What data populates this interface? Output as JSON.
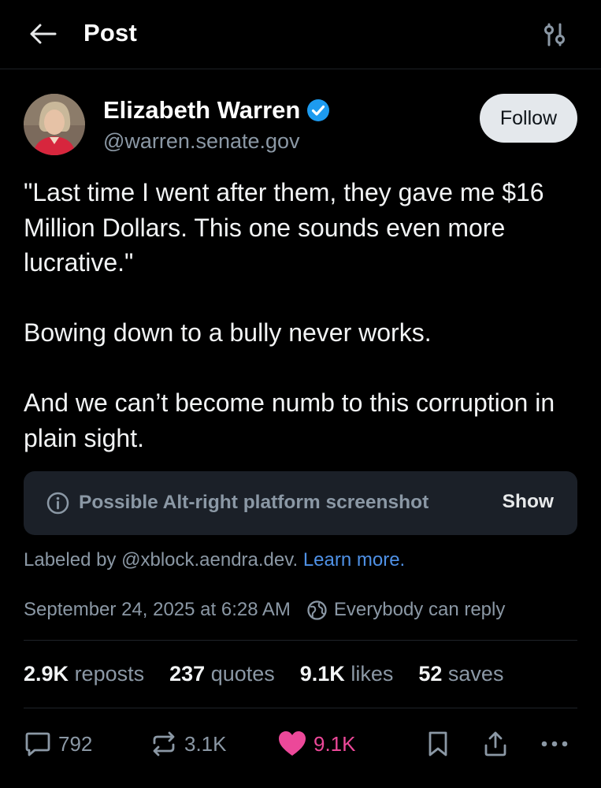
{
  "header": {
    "title": "Post",
    "back_icon": "arrow-left-icon",
    "settings_icon": "sliders-icon"
  },
  "author": {
    "name": "Elizabeth Warren",
    "handle": "@warren.senate.gov",
    "verified": true,
    "verified_color": "#1d9bf0"
  },
  "follow_label": "Follow",
  "post": {
    "text": "\"Last time I went after them, they gave me $16 Million Dollars. This one sounds even more lucrative.\"\n\nBowing down to a bully never works.\n\nAnd we can’t become numb to this corruption in plain sight."
  },
  "content_label": {
    "text": "Possible Alt-right platform screenshot",
    "show_label": "Show",
    "labeled_by_prefix": "Labeled by @xblock.aendra.dev.",
    "learn_more": "Learn more."
  },
  "meta": {
    "timestamp": "September 24, 2025 at 6:28 AM",
    "reply_setting": "Everybody can reply"
  },
  "stats": {
    "reposts": {
      "count": "2.9K",
      "label": "reposts"
    },
    "quotes": {
      "count": "237",
      "label": "quotes"
    },
    "likes": {
      "count": "9.1K",
      "label": "likes"
    },
    "saves": {
      "count": "52",
      "label": "saves"
    }
  },
  "actions": {
    "reply_count": "792",
    "repost_count": "3.1K",
    "like_count": "9.1K",
    "like_color": "#ec4899"
  }
}
